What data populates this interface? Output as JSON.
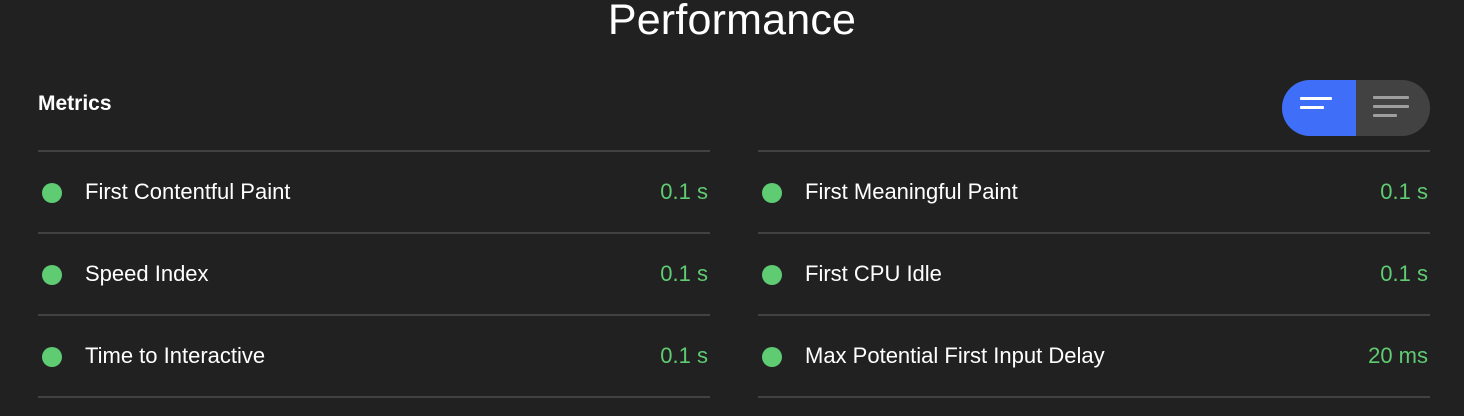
{
  "header": {
    "title": "Performance"
  },
  "metrics": {
    "section_title": "Metrics",
    "toggle": {
      "compact_icon": "compact-view-icon",
      "expanded_icon": "expanded-view-icon",
      "active": "compact"
    },
    "left": [
      {
        "label": "First Contentful Paint",
        "value": "0.1 s",
        "status": "pass"
      },
      {
        "label": "Speed Index",
        "value": "0.1 s",
        "status": "pass"
      },
      {
        "label": "Time to Interactive",
        "value": "0.1 s",
        "status": "pass"
      }
    ],
    "right": [
      {
        "label": "First Meaningful Paint",
        "value": "0.1 s",
        "status": "pass"
      },
      {
        "label": "First CPU Idle",
        "value": "0.1 s",
        "status": "pass"
      },
      {
        "label": "Max Potential First Input Delay",
        "value": "20 ms",
        "status": "pass"
      }
    ]
  },
  "colors": {
    "background": "#212121",
    "pass": "#5fcb73",
    "accent": "#3f6ff8",
    "divider": "#424242"
  }
}
